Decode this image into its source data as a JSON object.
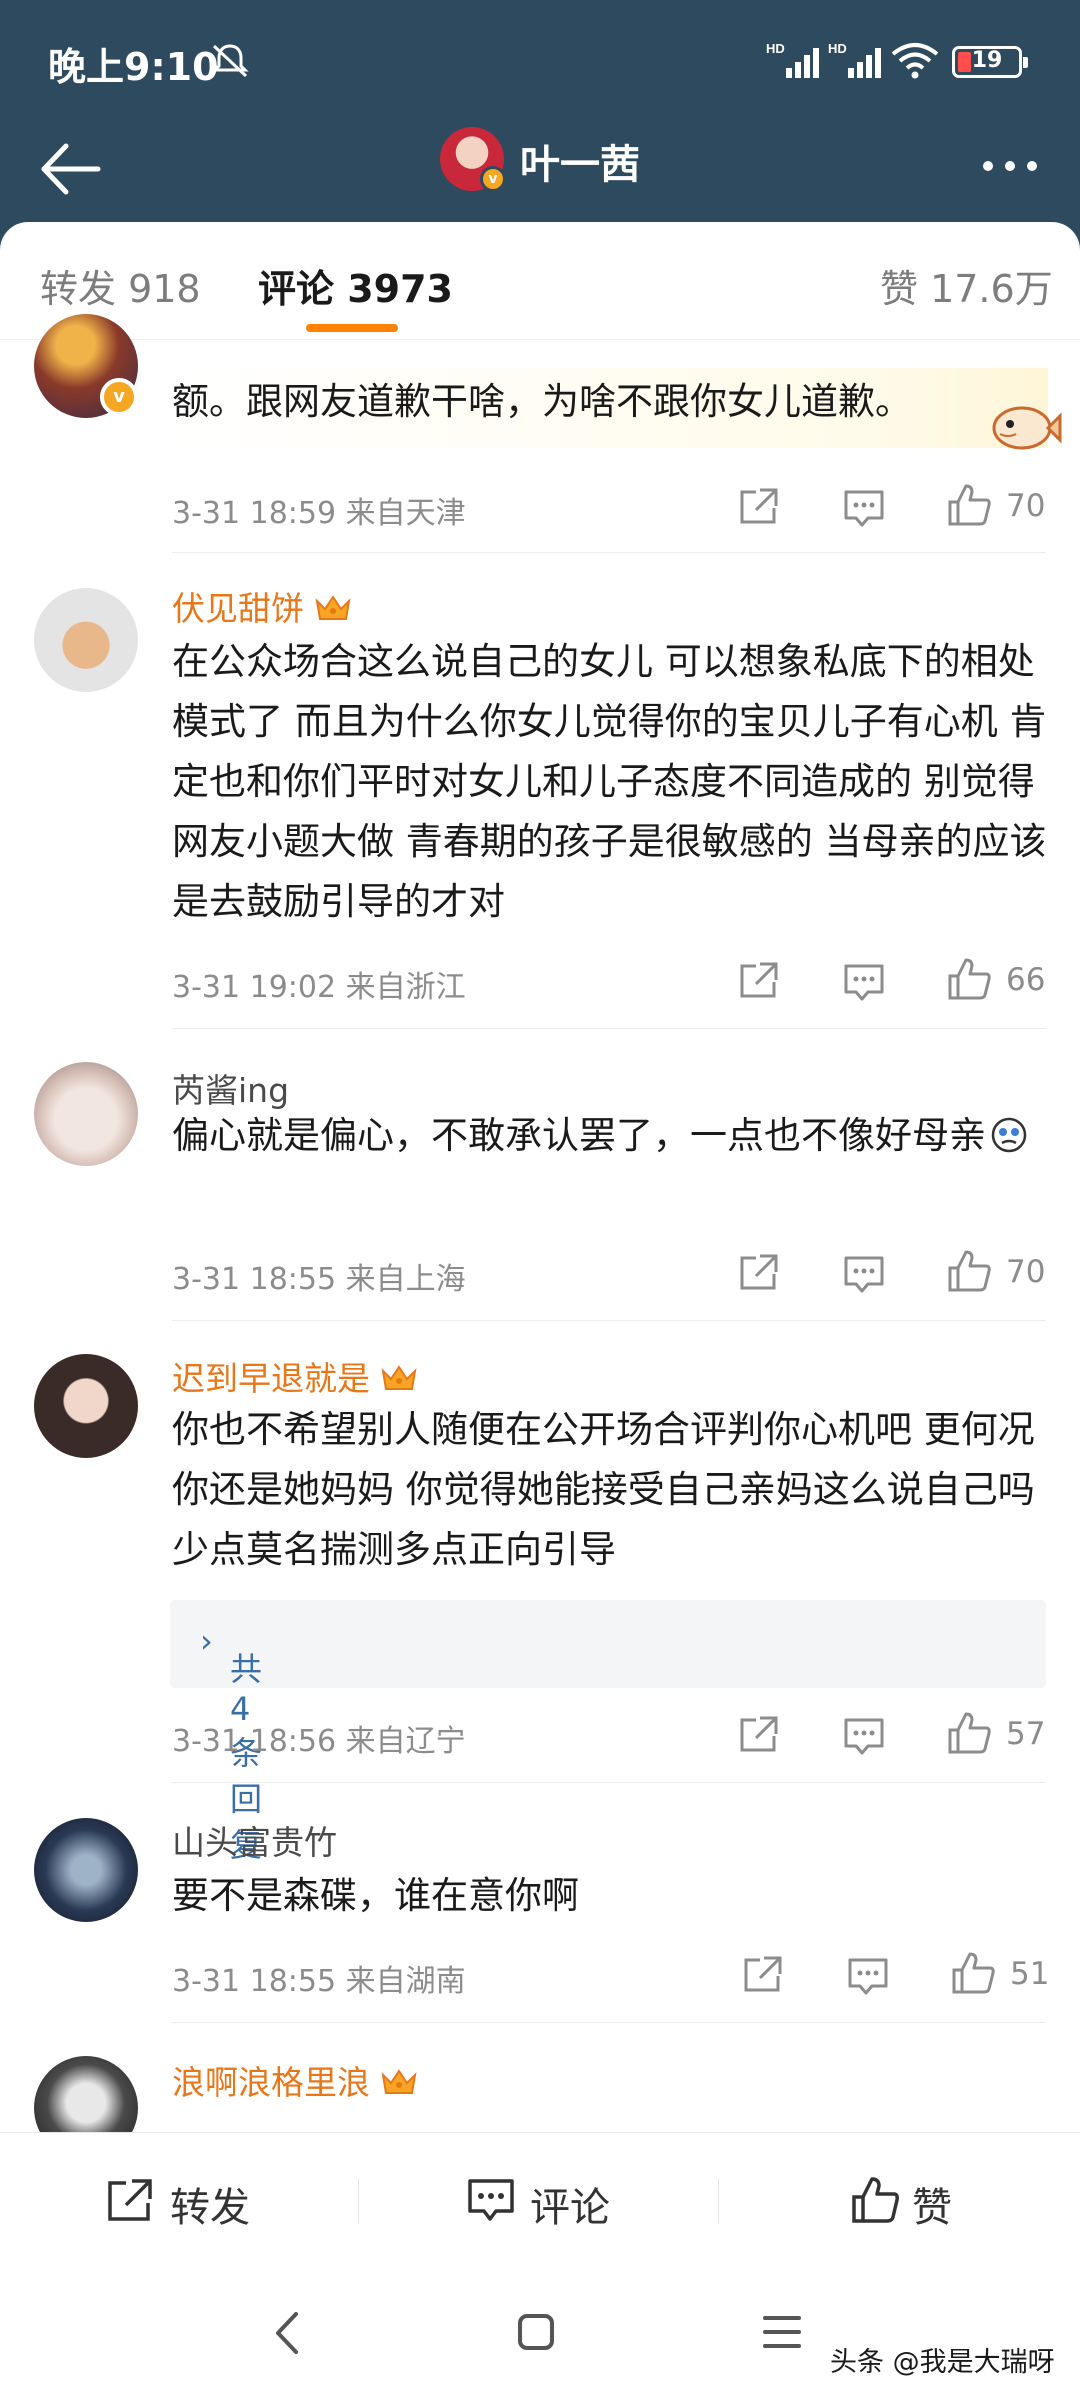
{
  "status_bar": {
    "time": "晚上9:10",
    "network_1": "HD",
    "network_2": "HD",
    "battery": "19"
  },
  "header": {
    "title": "叶一茜",
    "verified_icon": "v-badge-icon"
  },
  "tabs": {
    "repost": "转发 918",
    "comments": "评论 3973",
    "likes": "赞 17.6万"
  },
  "comments": [
    {
      "name": "",
      "text": "额。跟网友道歉干啥，为啥不跟你女儿道歉。",
      "time_location": "3-31 18:59 来自天津",
      "likes": "70"
    },
    {
      "name": "伏见甜饼",
      "vip": true,
      "text": "在公众场合这么说自己的女儿 可以想象私底下的相处模式了 而且为什么你女儿觉得你的宝贝儿子有心机 肯定也和你们平时对女儿和儿子态度不同造成的 别觉得网友小题大做  青春期的孩子是很敏感的 当母亲的应该是去鼓励引导的才对",
      "time_location": "3-31 19:02 来自浙江",
      "likes": "66"
    },
    {
      "name": "芮酱ing",
      "vip": false,
      "text": "偏心就是偏心，不敢承认罢了，一点也不像好母亲",
      "time_location": "3-31 18:55 来自上海",
      "likes": "70"
    },
    {
      "name": "迟到早退就是",
      "vip": true,
      "text": "你也不希望别人随便在公开场合评判你心机吧 更何况你还是她妈妈 你觉得她能接受自己亲妈这么说自己吗 少点莫名揣测多点正向引导",
      "replies": "共4条回复",
      "time_location": "3-31 18:56 来自辽宁",
      "likes": "57"
    },
    {
      "name": "山头富贵竹",
      "vip": false,
      "text": "要不是森碟，谁在意你啊",
      "time_location": "3-31 18:55 来自湖南",
      "likes": "51"
    },
    {
      "name": "浪啊浪格里浪",
      "vip": true
    }
  ],
  "action_bar": {
    "repost": "转发",
    "comment": "评论",
    "like": "赞"
  },
  "watermark": "头条 @我是大瑞呀",
  "colors": {
    "header_bg": "#2e4a5e",
    "accent": "#ff8200",
    "vip_name": "#e8771a",
    "reply_link": "#3b6ea5"
  }
}
